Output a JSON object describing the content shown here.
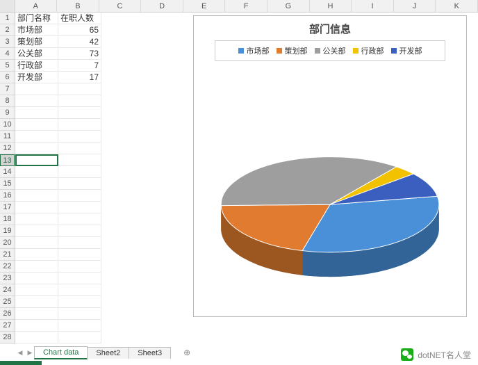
{
  "columns": [
    "A",
    "B",
    "C",
    "D",
    "E",
    "F",
    "G",
    "H",
    "I",
    "J",
    "K"
  ],
  "row_count": 28,
  "selected_row": 13,
  "table": {
    "headers": [
      "部门名称",
      "在职人数"
    ],
    "rows": [
      {
        "name": "市场部",
        "count": 65
      },
      {
        "name": "策划部",
        "count": 42
      },
      {
        "name": "公关部",
        "count": 73
      },
      {
        "name": "行政部",
        "count": 7
      },
      {
        "name": "开发部",
        "count": 17
      }
    ]
  },
  "chart_data": {
    "type": "pie",
    "title": "部门信息",
    "series": [
      {
        "name": "市场部",
        "value": 65,
        "color": "#4a90d9"
      },
      {
        "name": "策划部",
        "value": 42,
        "color": "#e07b2f"
      },
      {
        "name": "公关部",
        "value": 73,
        "color": "#9e9e9e"
      },
      {
        "name": "行政部",
        "value": 7,
        "color": "#f2c200"
      },
      {
        "name": "开发部",
        "value": 17,
        "color": "#3a5fbf"
      }
    ]
  },
  "tabs": {
    "items": [
      "Chart data",
      "Sheet2",
      "Sheet3"
    ],
    "active": 0
  },
  "watermark": "dotNET名人堂"
}
